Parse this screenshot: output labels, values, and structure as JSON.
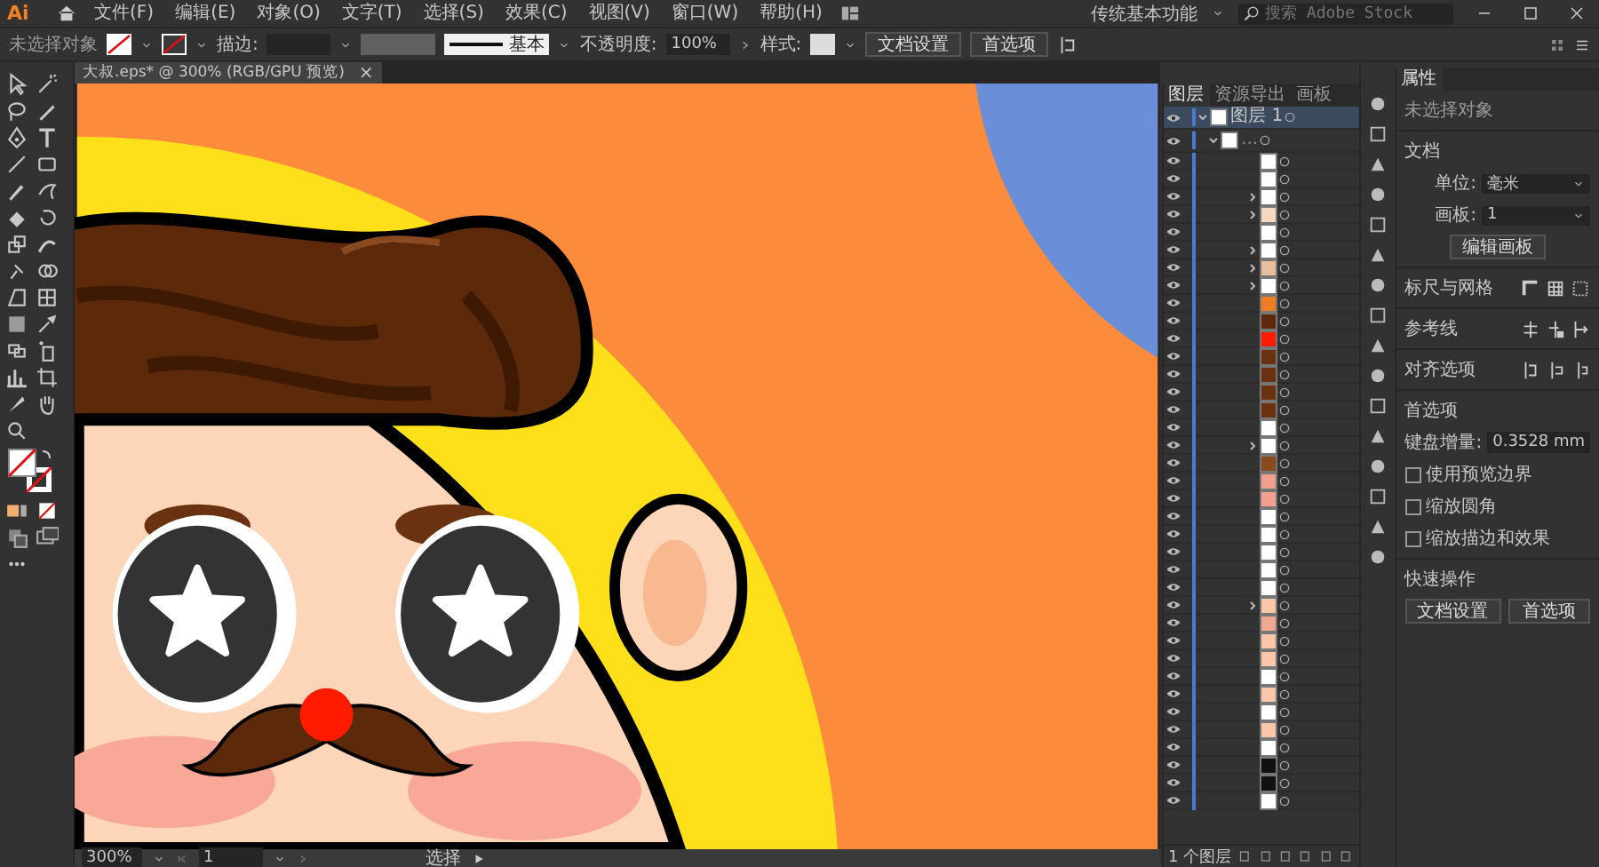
{
  "app": {
    "logo": "Ai"
  },
  "menu": [
    "文件(F)",
    "编辑(E)",
    "对象(O)",
    "文字(T)",
    "选择(S)",
    "效果(C)",
    "视图(V)",
    "窗口(W)",
    "帮助(H)"
  ],
  "workspace": {
    "label": "传统基本功能",
    "search_placeholder": "搜索 Adobe Stock"
  },
  "control_bar": {
    "selection": "未选择对象",
    "stroke_label": "描边:",
    "stroke_style": "基本",
    "opacity_label": "不透明度:",
    "opacity": "100%",
    "style_label": "样式:",
    "buttons": [
      "文档设置",
      "首选项"
    ]
  },
  "document_tab": {
    "title": "大叔.eps* @ 300% (RGB/GPU 预览)",
    "close": "×"
  },
  "status_bar": {
    "zoom": "300%",
    "artboard": "1",
    "tool": "选择"
  },
  "layers_panel": {
    "tabs": [
      {
        "label": "图层",
        "selected": true
      },
      {
        "label": "资源导出",
        "selected": false
      },
      {
        "label": "画板",
        "selected": false
      }
    ],
    "layer": {
      "name": "图层 1",
      "expanded": true,
      "selected": true
    },
    "group": {
      "name": "...",
      "expanded": true,
      "selected": false
    },
    "rows": [
      {
        "kind": "path",
        "color": "#ffffff"
      },
      {
        "kind": "path",
        "color": "#ffffff"
      },
      {
        "kind": "group",
        "color": "#ffffff"
      },
      {
        "kind": "group",
        "color": "#f4d8c0"
      },
      {
        "kind": "path",
        "color": "#ffffff"
      },
      {
        "kind": "group",
        "color": "#ffffff"
      },
      {
        "kind": "group",
        "color": "#e8c0a0"
      },
      {
        "kind": "group",
        "color": "#ffffff"
      },
      {
        "kind": "path",
        "color": "#f07c28"
      },
      {
        "kind": "path",
        "color": "#5a2a0a"
      },
      {
        "kind": "path",
        "color": "#ff1a00"
      },
      {
        "kind": "path",
        "color": "#6a3210"
      },
      {
        "kind": "path",
        "color": "#6a3210"
      },
      {
        "kind": "path",
        "color": "#6a3210"
      },
      {
        "kind": "path",
        "color": "#6a3210"
      },
      {
        "kind": "path",
        "color": "#ffffff"
      },
      {
        "kind": "group",
        "color": "#ffffff"
      },
      {
        "kind": "path",
        "color": "#8a4a20"
      },
      {
        "kind": "path",
        "color": "#f4a090"
      },
      {
        "kind": "path",
        "color": "#f4a090"
      },
      {
        "kind": "path",
        "color": "#ffffff"
      },
      {
        "kind": "path",
        "color": "#ffffff"
      },
      {
        "kind": "path",
        "color": "#ffffff"
      },
      {
        "kind": "path",
        "color": "#ffffff"
      },
      {
        "kind": "path",
        "color": "#ffffff"
      },
      {
        "kind": "group",
        "color": "#f8c8a8"
      },
      {
        "kind": "path",
        "color": "#f0a890"
      },
      {
        "kind": "path",
        "color": "#f8c8a8"
      },
      {
        "kind": "path",
        "color": "#f8c8a8"
      },
      {
        "kind": "path",
        "color": "#ffffff"
      },
      {
        "kind": "path",
        "color": "#f8c8a8"
      },
      {
        "kind": "path",
        "color": "#ffffff"
      },
      {
        "kind": "path",
        "color": "#f8c8a8"
      },
      {
        "kind": "path",
        "color": "#ffffff"
      },
      {
        "kind": "path",
        "color": "#111111"
      },
      {
        "kind": "path",
        "color": "#111111"
      },
      {
        "kind": "path",
        "color": "#ffffff"
      }
    ],
    "footer": "1 个图层"
  },
  "properties_panel": {
    "tab": "属性",
    "selection": "未选择对象",
    "document_heading": "文档",
    "unit_label": "单位:",
    "unit": "毫米",
    "artboard_label": "画板:",
    "artboard": "1",
    "edit_artboards": "编辑画板",
    "rulers_grids": "标尺与网格",
    "guides": "参考线",
    "snap_options": "对齐选项",
    "preferences_heading": "首选项",
    "keyboard_increment_label": "键盘增量:",
    "keyboard_increment": "0.3528 mm",
    "checkboxes": [
      {
        "label": "使用预览边界",
        "checked": false
      },
      {
        "label": "缩放圆角",
        "checked": false
      },
      {
        "label": "缩放描边和效果",
        "checked": false
      }
    ],
    "quick_actions": "快速操作",
    "quick_buttons": [
      "文档设置",
      "首选项"
    ]
  }
}
